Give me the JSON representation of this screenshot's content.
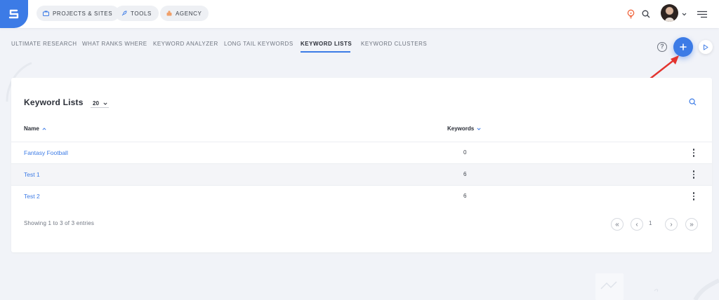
{
  "topbar": {
    "pills": [
      {
        "label": "PROJECTS & SITES",
        "icon": "briefcase-icon"
      },
      {
        "label": "TOOLS",
        "icon": "rocket-icon"
      },
      {
        "label": "AGENCY",
        "icon": "agency-icon"
      }
    ],
    "icons": [
      "lightbulb-icon",
      "search-icon",
      "avatar",
      "chevron-down-icon",
      "hamburger-menu-icon"
    ]
  },
  "subnav": {
    "tabs": [
      {
        "label": "ULTIMATE RESEARCH",
        "active": false
      },
      {
        "label": "WHAT RANKS WHERE",
        "active": false
      },
      {
        "label": "KEYWORD ANALYZER",
        "active": false
      },
      {
        "label": "LONG TAIL KEYWORDS",
        "active": false
      },
      {
        "label": "KEYWORD LISTS",
        "active": true
      },
      {
        "label": "KEYWORD CLUSTERS",
        "active": false
      }
    ],
    "help_label": "?"
  },
  "card": {
    "title": "Keyword Lists",
    "page_size": "20",
    "columns": {
      "name": "Name",
      "keywords": "Keywords"
    },
    "rows": [
      {
        "name": "Fantasy Football",
        "keywords": "0"
      },
      {
        "name": "Test 1",
        "keywords": "6"
      },
      {
        "name": "Test 2",
        "keywords": "6"
      }
    ],
    "entries_text": "Showing 1 to 3 of 3 entries",
    "pagination": {
      "first": "«",
      "prev": "‹",
      "page": "1",
      "next": "›",
      "last": "»"
    }
  },
  "colors": {
    "accent": "#3c7be6",
    "background": "#f1f3f8",
    "annotation_arrow": "#e3342f",
    "bulb": "#f0643c"
  }
}
